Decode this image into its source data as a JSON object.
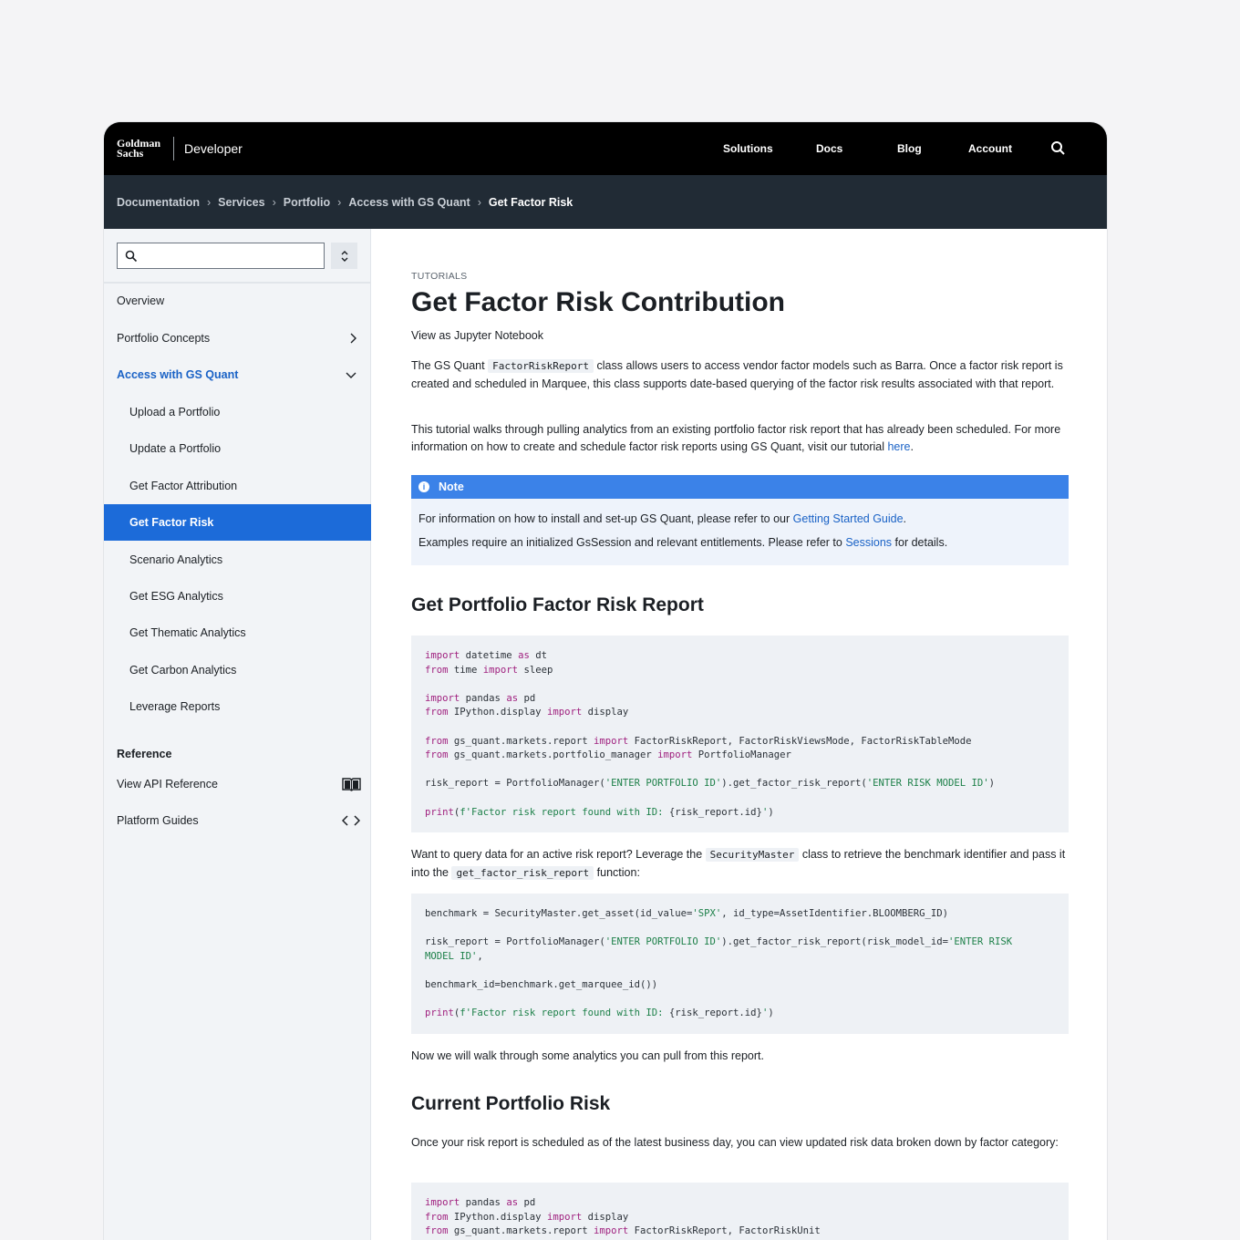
{
  "header": {
    "logo_line1": "Goldman",
    "logo_line2": "Sachs",
    "brand": "Developer",
    "nav": [
      "Solutions",
      "Docs",
      "Blog",
      "Account"
    ],
    "search_icon": "search-icon"
  },
  "breadcrumb": [
    "Documentation",
    "Services",
    "Portfolio",
    "Access with GS Quant",
    "Get Factor Risk"
  ],
  "sidebar": {
    "search_placeholder": "",
    "items": [
      {
        "label": "Overview"
      },
      {
        "label": "Portfolio Concepts"
      },
      {
        "label": "Access with GS Quant"
      },
      {
        "label": "Upload a Portfolio"
      },
      {
        "label": "Update a Portfolio"
      },
      {
        "label": "Get Factor Attribution"
      },
      {
        "label": "Get Factor Risk"
      },
      {
        "label": "Scenario Analytics"
      },
      {
        "label": "Get ESG Analytics"
      },
      {
        "label": "Get Thematic Analytics"
      },
      {
        "label": "Get Carbon Analytics"
      },
      {
        "label": "Leverage Reports"
      }
    ],
    "reference_heading": "Reference",
    "reference_items": [
      {
        "label": "View API Reference",
        "icon": "book-icon"
      },
      {
        "label": "Platform Guides",
        "icon": "code-icon"
      }
    ]
  },
  "content": {
    "eyebrow": "TUTORIALS",
    "title": "Get Factor Risk Contribution",
    "notebook_link": "View as Jupyter Notebook",
    "intro1_a": "The GS Quant ",
    "intro1_code": "FactorRiskReport",
    "intro1_b": " class allows users to access vendor factor models such as Barra. Once a factor risk report is created and scheduled in Marquee, this class supports date-based querying of the factor risk results associated with that report.",
    "intro2_a": "This tutorial walks through pulling analytics from an existing portfolio factor risk report that has already been scheduled. For more information on how to create and schedule factor risk reports using GS Quant, visit our tutorial ",
    "intro2_link": "here",
    "intro2_b": ".",
    "note": {
      "title": "Note",
      "line1_a": "For information on how to install and set-up GS Quant, please refer to our ",
      "line1_link": "Getting Started Guide",
      "line1_b": ".",
      "line2_a": "Examples require an initialized GsSession and relevant entitlements. Please refer to ",
      "line2_link": "Sessions",
      "line2_b": " for details."
    },
    "h2_report": "Get Portfolio Factor Risk Report",
    "query_a": "Want to query data for an active risk report? Leverage the ",
    "query_code1": "SecurityMaster",
    "query_b": " class to retrieve the benchmark identifier and pass it into the ",
    "query_code2": "get_factor_risk_report",
    "query_c": " function:",
    "walk_text": "Now we will walk through some analytics you can pull from this report.",
    "h2_current": "Current Portfolio Risk",
    "current_text": "Once your risk report is scheduled as of the latest business day, you can view updated risk data broken down by factor category:"
  }
}
